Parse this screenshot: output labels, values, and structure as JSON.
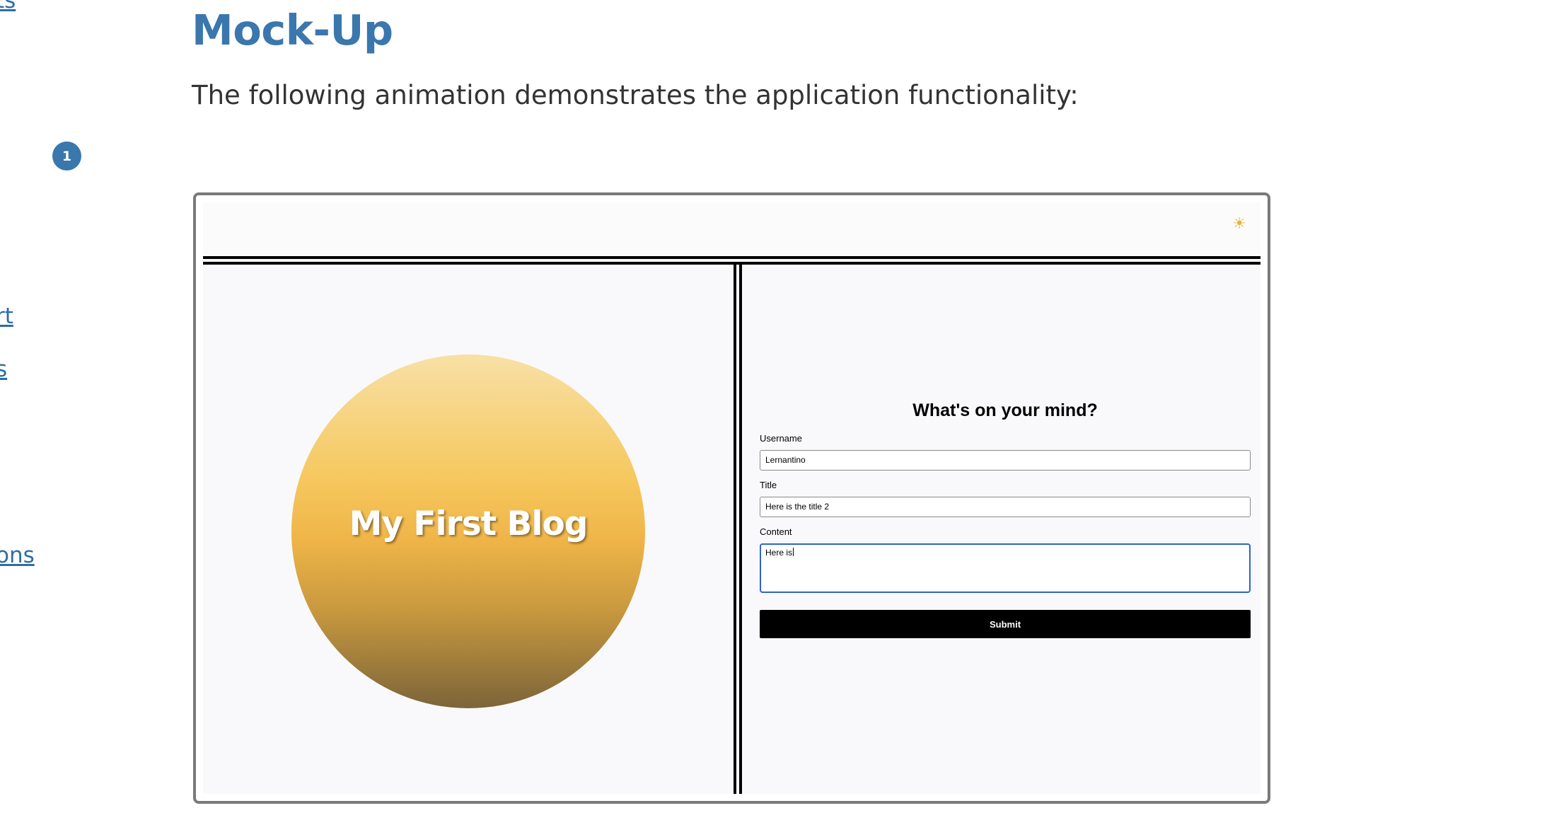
{
  "sidebar": {
    "links": [
      "ts",
      "rt",
      "s",
      "ons"
    ],
    "step_badge": "1"
  },
  "header": {
    "title": "Mock-Up",
    "lead": "The following animation demonstrates the application functionality:"
  },
  "mockup": {
    "theme_icon": "sun-icon",
    "theme_glyph": "☀",
    "blog_title": "My First Blog",
    "form": {
      "heading": "What's on your mind?",
      "username_label": "Username",
      "username_value": "Lernantino",
      "title_label": "Title",
      "title_value": "Here is the title 2",
      "content_label": "Content",
      "content_value": "Here is",
      "submit_label": "Submit"
    }
  },
  "colors": {
    "heading_blue": "#3a77ad",
    "link_blue": "#2e6da4",
    "focus_blue": "#2f64c8"
  }
}
